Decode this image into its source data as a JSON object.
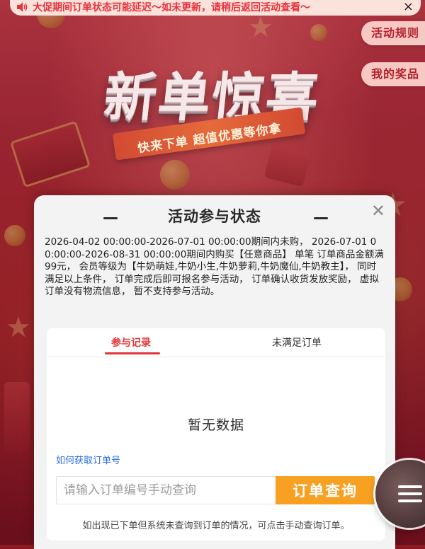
{
  "notice": {
    "text": "大促期间订单状态可能延迟～如未更新，请稍后返回活动查看～",
    "close": "×"
  },
  "hero": {
    "title": "新单惊喜",
    "subtitle": "快来下单 超值优惠等你拿"
  },
  "side_links": {
    "rules": "活动规则",
    "prizes": "我的奖品"
  },
  "modal": {
    "title": "活动参与状态",
    "close": "✕",
    "description": "2026-04-02 00:00:00-2026-07-01 00:00:00期间内未购， 2026-07-01 00:00:00-2026-08-31 00:00:00期间内购买【任意商品】 单笔 订单商品金额满99元， 会员等级为【牛奶萌娃,牛奶小生,牛奶萝莉,牛奶魔仙,牛奶教主】， 同时满足以上条件， 订单完成后即可报名参与活动， 订单确认收货发放奖励， 虚拟订单没有物流信息， 暂不支持参与活动。",
    "tabs": [
      {
        "label": "参与记录",
        "active": true
      },
      {
        "label": "未满足订单",
        "active": false
      }
    ],
    "empty_text": "暂无数据",
    "how_to_link": "如何获取订单号",
    "query": {
      "placeholder": "请输入订单编号手动查询",
      "value": "",
      "button": "订单查询"
    },
    "hint": "如出现已下单但系统未查询到订单的情况，可点击手动查询订单。"
  },
  "colors": {
    "accent_red": "#e23437",
    "query_button": "#f7a021",
    "link_blue": "#2a6de0",
    "notice_text": "#e8323c"
  },
  "icons": {
    "notice": "speaker-icon",
    "close": "close-icon",
    "menu": "menu-icon"
  }
}
